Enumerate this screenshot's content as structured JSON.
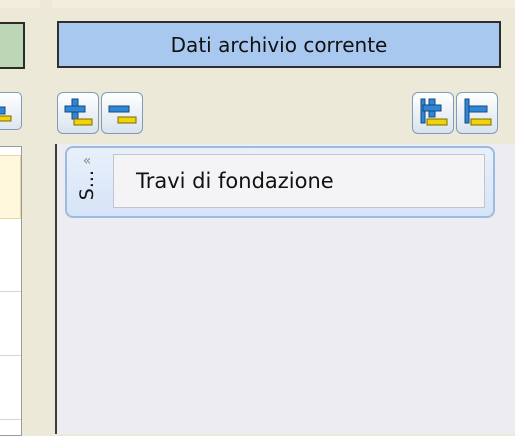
{
  "panel": {
    "title": "Dati archivio corrente"
  },
  "toolbar": {
    "buttons": [
      {
        "icon": "add-item-icon"
      },
      {
        "icon": "remove-item-icon"
      },
      {
        "icon": "add-group-icon"
      },
      {
        "icon": "remove-group-icon"
      }
    ]
  },
  "items": [
    {
      "tab_label": "S...",
      "text": "Travi di fondazione"
    }
  ],
  "colors": {
    "header_bg": "#a9c8ef",
    "item_bg": "#d6e4f7",
    "icon_plus": "#2f86d6",
    "icon_minus": "#f2d30a"
  }
}
